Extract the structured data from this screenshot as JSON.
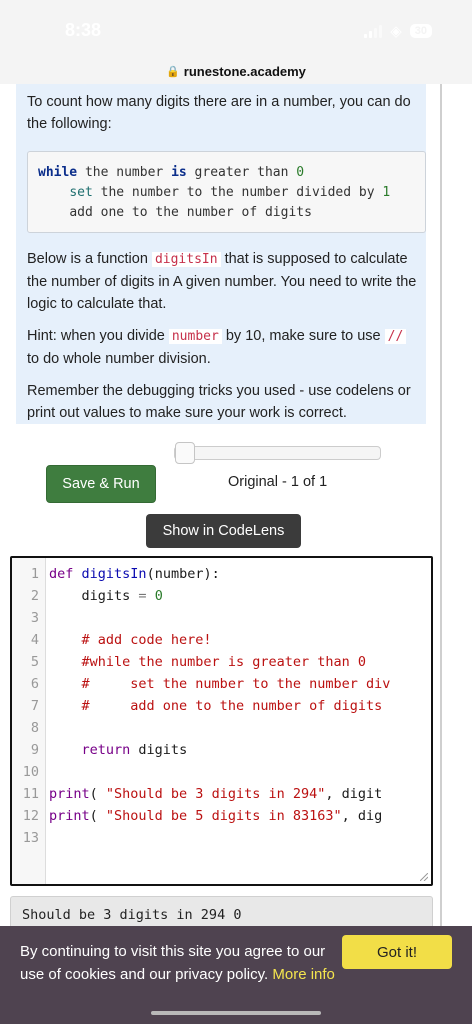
{
  "status_bar": {
    "time": "8:38",
    "battery": "30"
  },
  "browser": {
    "url": "runestone.academy"
  },
  "intro": {
    "text": "To count how many digits there are in a number, you can do the following:"
  },
  "pseudocode": [
    {
      "kw": "while",
      "a": " the number ",
      "kw2": "is",
      "b": " greater than ",
      "num": "0"
    },
    {
      "indent": "    ",
      "kw": "set",
      "a": " the number to the number divided by ",
      "num": "1"
    },
    {
      "indent": "    ",
      "a": "add one to the number of digits"
    }
  ],
  "description": {
    "p1_a": "Below is a function ",
    "p1_code": "digitsIn",
    "p1_b": " that is supposed to calculate the number of digits in A given number. You need to write the logic to calculate that.",
    "p2_a": "Hint: when you divide ",
    "p2_code": "number",
    "p2_b": " by 10, make sure to use ",
    "p2_code2": "//",
    "p2_c": " to do whole number division.",
    "p3": "Remember the debugging tricks you used - use codelens or print out values to make sure your work is correct."
  },
  "controls": {
    "save_run": "Save & Run",
    "version": "Original - 1 of 1",
    "codelens": "Show in CodeLens",
    "slider_position": 0
  },
  "code_lines": [
    {
      "n": "1",
      "parts": [
        {
          "t": "def",
          "c": "def"
        },
        {
          "t": " "
        },
        {
          "t": "digitsIn",
          "c": "fn"
        },
        {
          "t": "(number):"
        }
      ]
    },
    {
      "n": "2",
      "parts": [
        {
          "t": "    digits "
        },
        {
          "t": "=",
          "c": "op"
        },
        {
          "t": " "
        },
        {
          "t": "0",
          "c": "num"
        }
      ]
    },
    {
      "n": "3",
      "parts": []
    },
    {
      "n": "4",
      "parts": [
        {
          "t": "    "
        },
        {
          "t": "# add code here!",
          "c": "cm"
        }
      ]
    },
    {
      "n": "5",
      "parts": [
        {
          "t": "    "
        },
        {
          "t": "#while the number is greater than 0",
          "c": "cm"
        }
      ]
    },
    {
      "n": "6",
      "parts": [
        {
          "t": "    "
        },
        {
          "t": "#     set the number to the number div",
          "c": "cm"
        }
      ]
    },
    {
      "n": "7",
      "parts": [
        {
          "t": "    "
        },
        {
          "t": "#     add one to the number of digits",
          "c": "cm"
        }
      ]
    },
    {
      "n": "8",
      "parts": []
    },
    {
      "n": "9",
      "parts": [
        {
          "t": "    "
        },
        {
          "t": "return",
          "c": "def"
        },
        {
          "t": " digits"
        }
      ]
    },
    {
      "n": "10",
      "parts": []
    },
    {
      "n": "11",
      "parts": [
        {
          "t": "print",
          "c": "def"
        },
        {
          "t": "( "
        },
        {
          "t": "\"Should be 3 digits in 294\"",
          "c": "str"
        },
        {
          "t": ", digit"
        }
      ]
    },
    {
      "n": "12",
      "parts": [
        {
          "t": "print",
          "c": "def"
        },
        {
          "t": "( "
        },
        {
          "t": "\"Should be 5 digits in 83163\"",
          "c": "str"
        },
        {
          "t": ", dig"
        }
      ]
    },
    {
      "n": "13",
      "parts": []
    }
  ],
  "output": {
    "text": "Should be 3 digits in 294 0"
  },
  "cookie": {
    "text": "By continuing to visit this site you agree to our use of cookies and our privacy policy. ",
    "more": "More info",
    "button": "Got it!"
  }
}
